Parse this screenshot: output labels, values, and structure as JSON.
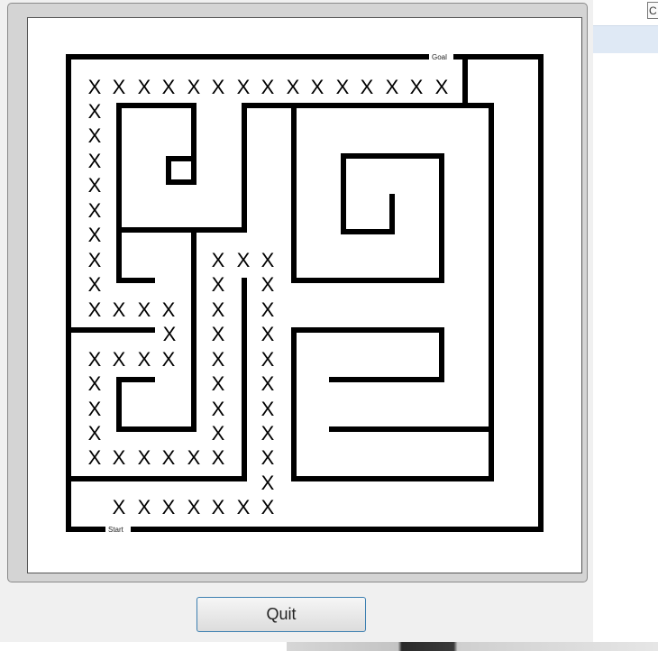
{
  "maze": {
    "goal_label": "Goal",
    "start_label": "Start",
    "path_mark": "X"
  },
  "buttons": {
    "quit_label": "Quit"
  },
  "corner_box_text": "C"
}
